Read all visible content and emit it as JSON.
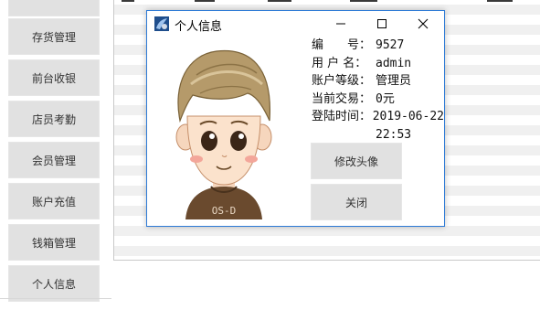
{
  "sidebar": {
    "items": [
      {
        "label": ""
      },
      {
        "label": "存货管理"
      },
      {
        "label": "前台收银"
      },
      {
        "label": "店员考勤"
      },
      {
        "label": "会员管理"
      },
      {
        "label": "账户充值"
      },
      {
        "label": "钱箱管理"
      },
      {
        "label": "个人信息"
      }
    ]
  },
  "dialog": {
    "title": "个人信息",
    "info": [
      {
        "label": "编　　号：",
        "value": "9527"
      },
      {
        "label": "用 户 名：",
        "value": "admin"
      },
      {
        "label": "账户等级：",
        "value": "管理员"
      },
      {
        "label": "当前交易：",
        "value": "0元"
      },
      {
        "label": "登陆时间：",
        "value": "2019-06-22"
      },
      {
        "label": "",
        "value": "22:53"
      }
    ],
    "change_avatar_label": "修改头像",
    "close_label": "关闭",
    "avatar_shirt_text": "OS-D"
  },
  "colors": {
    "dialog_border": "#2f7bd6",
    "button_bg": "#e1e1e1",
    "grid_stripe": "#f0f0f0"
  }
}
